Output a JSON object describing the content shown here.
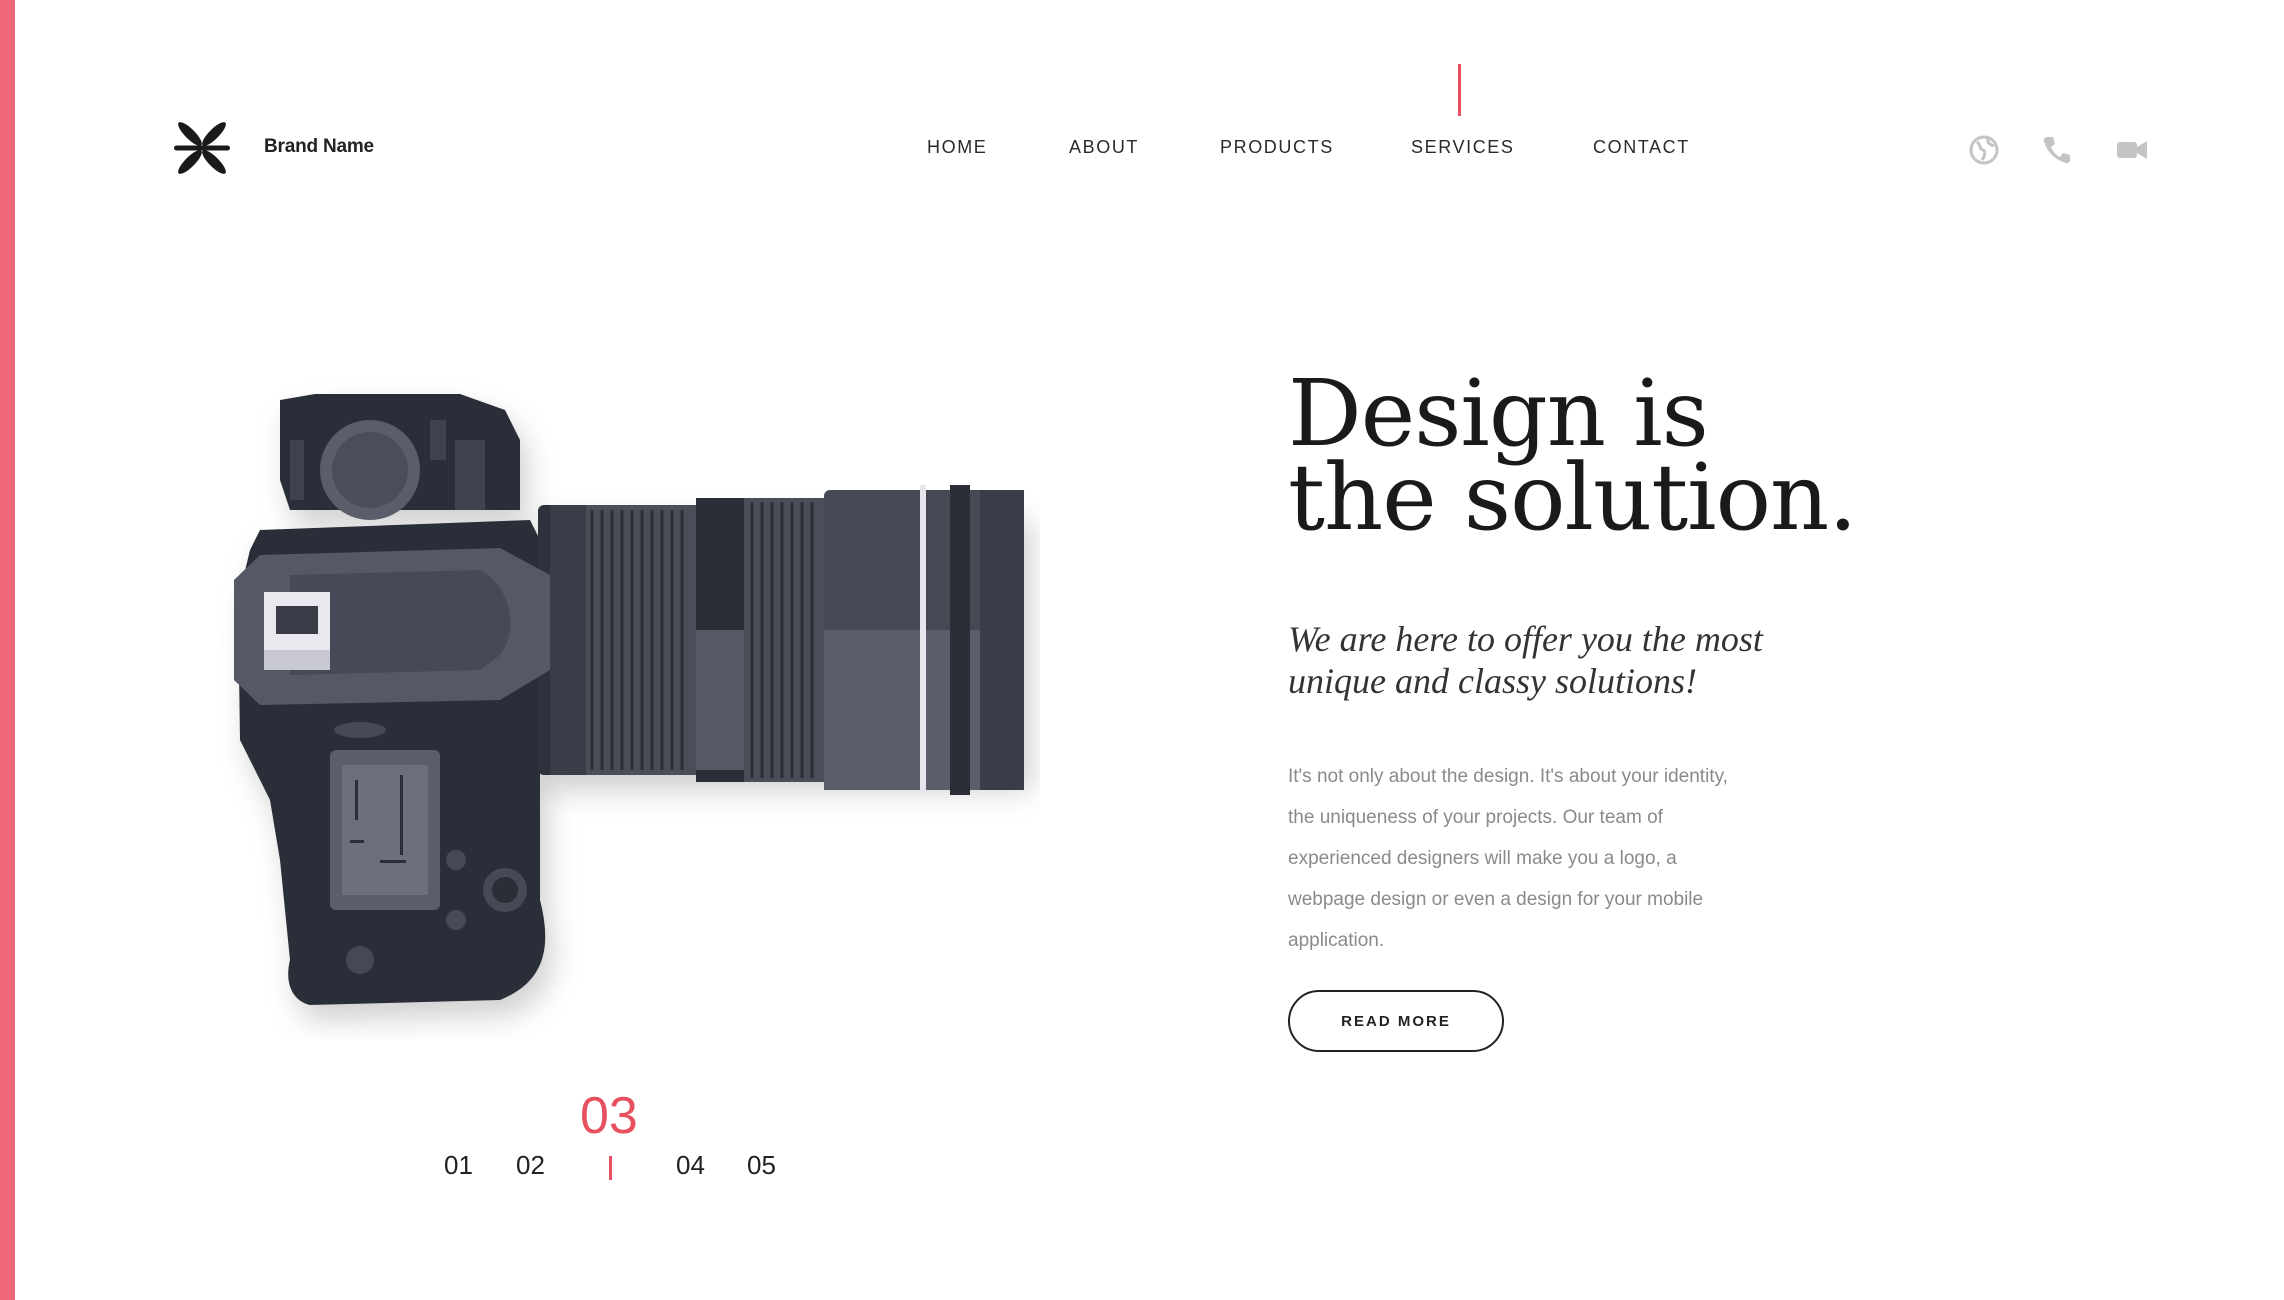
{
  "brand": {
    "name": "Brand Name"
  },
  "nav": {
    "items": [
      {
        "label": "HOME"
      },
      {
        "label": "ABOUT"
      },
      {
        "label": "PRODUCTS"
      },
      {
        "label": "SERVICES"
      },
      {
        "label": "CONTACT"
      }
    ],
    "active": "SERVICES"
  },
  "header_icons": [
    "globe-icon",
    "phone-icon",
    "video-camera-icon"
  ],
  "hero": {
    "headline_line1": "Design is",
    "headline_line2": "the solution.",
    "subheadline": "We are here to offer you the most unique and classy solutions!",
    "body": "It's not only about the design. It's about your identity, the uniqueness of your projects. Our team of experienced designers will make you a logo, a webpage design or even a design for your mobile application.",
    "cta_label": "READ MORE"
  },
  "pagination": {
    "items": [
      "01",
      "02",
      "03",
      "04",
      "05"
    ],
    "active": "03"
  },
  "colors": {
    "accent": "#f0697a",
    "active_red": "#e8505f",
    "text_dark": "#222222",
    "text_muted": "#8a8a8a"
  }
}
